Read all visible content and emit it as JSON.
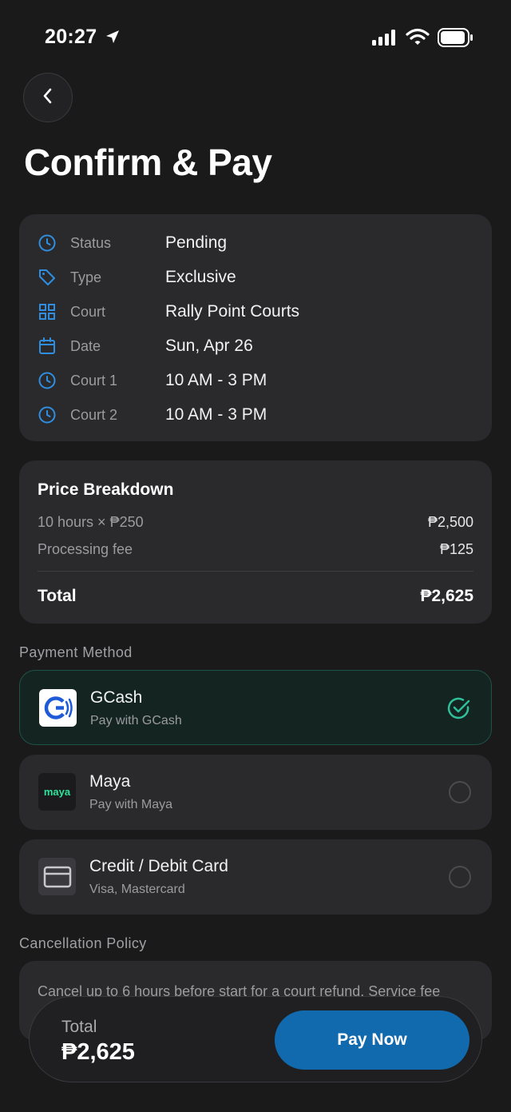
{
  "status_bar": {
    "time": "20:27"
  },
  "header": {
    "title": "Confirm & Pay"
  },
  "details": [
    {
      "icon": "clock-icon",
      "label": "Status",
      "value": "Pending"
    },
    {
      "icon": "tag-icon",
      "label": "Type",
      "value": "Exclusive"
    },
    {
      "icon": "grid-icon",
      "label": "Court",
      "value": "Rally Point Courts"
    },
    {
      "icon": "calendar-icon",
      "label": "Date",
      "value": "Sun, Apr 26"
    },
    {
      "icon": "clock-icon",
      "label": "Court 1",
      "value": "10 AM - 3 PM"
    },
    {
      "icon": "clock-icon",
      "label": "Court 2",
      "value": "10 AM - 3 PM"
    }
  ],
  "price_breakdown": {
    "title": "Price Breakdown",
    "rows": [
      {
        "label": "10 hours × ₱250",
        "amount": "₱2,500"
      },
      {
        "label": "Processing fee",
        "amount": "₱125"
      }
    ],
    "total_label": "Total",
    "total_amount": "₱2,625"
  },
  "payment": {
    "section_label": "Payment Method",
    "options": [
      {
        "name": "GCash",
        "sub": "Pay with GCash",
        "selected": true,
        "logo_text": "G"
      },
      {
        "name": "Maya",
        "sub": "Pay with Maya",
        "selected": false,
        "logo_text": "maya"
      },
      {
        "name": "Credit / Debit Card",
        "sub": "Visa, Mastercard",
        "selected": false
      }
    ]
  },
  "policy": {
    "section_label": "Cancellation Policy",
    "text": "Cancel up to 6 hours before start for a court refund. Service fee"
  },
  "bottom_bar": {
    "total_label": "Total",
    "total_amount": "₱2,625",
    "pay_button": "Pay Now"
  },
  "colors": {
    "accent_blue": "#116aad",
    "icon_blue": "#2f8ee0",
    "success_green": "#2fbf9a",
    "background": "#1a1a1b",
    "card": "#2a2a2d"
  }
}
